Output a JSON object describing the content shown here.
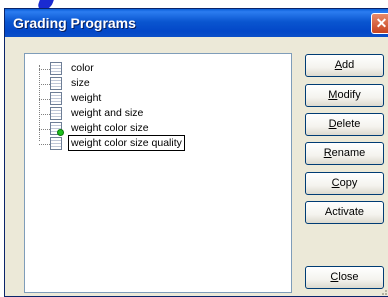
{
  "dialog": {
    "title": "Grading Programs",
    "close_glyph": "✕"
  },
  "tree": {
    "items": [
      {
        "label": "color",
        "icon": "document-icon",
        "selected": false
      },
      {
        "label": "size",
        "icon": "document-icon",
        "selected": false
      },
      {
        "label": "weight",
        "icon": "document-icon",
        "selected": false
      },
      {
        "label": "weight and size",
        "icon": "document-icon",
        "selected": false
      },
      {
        "label": "weight color size",
        "icon": "document-active-icon",
        "selected": false
      },
      {
        "label": "weight color size quality",
        "icon": "document-icon",
        "selected": true
      }
    ]
  },
  "buttons": {
    "add": {
      "accel": "A",
      "rest": "dd"
    },
    "modify": {
      "accel": "M",
      "rest": "odify"
    },
    "delete": {
      "accel": "D",
      "rest": "elete"
    },
    "rename": {
      "accel": "R",
      "rest": "ename"
    },
    "copy": {
      "accel": "C",
      "rest": "opy"
    },
    "activate": {
      "label": "Activate"
    },
    "close": {
      "accel": "C",
      "rest": "lose"
    }
  },
  "colors": {
    "titlebar": "#0a56d0",
    "active_indicator": "#1fbf1f"
  }
}
